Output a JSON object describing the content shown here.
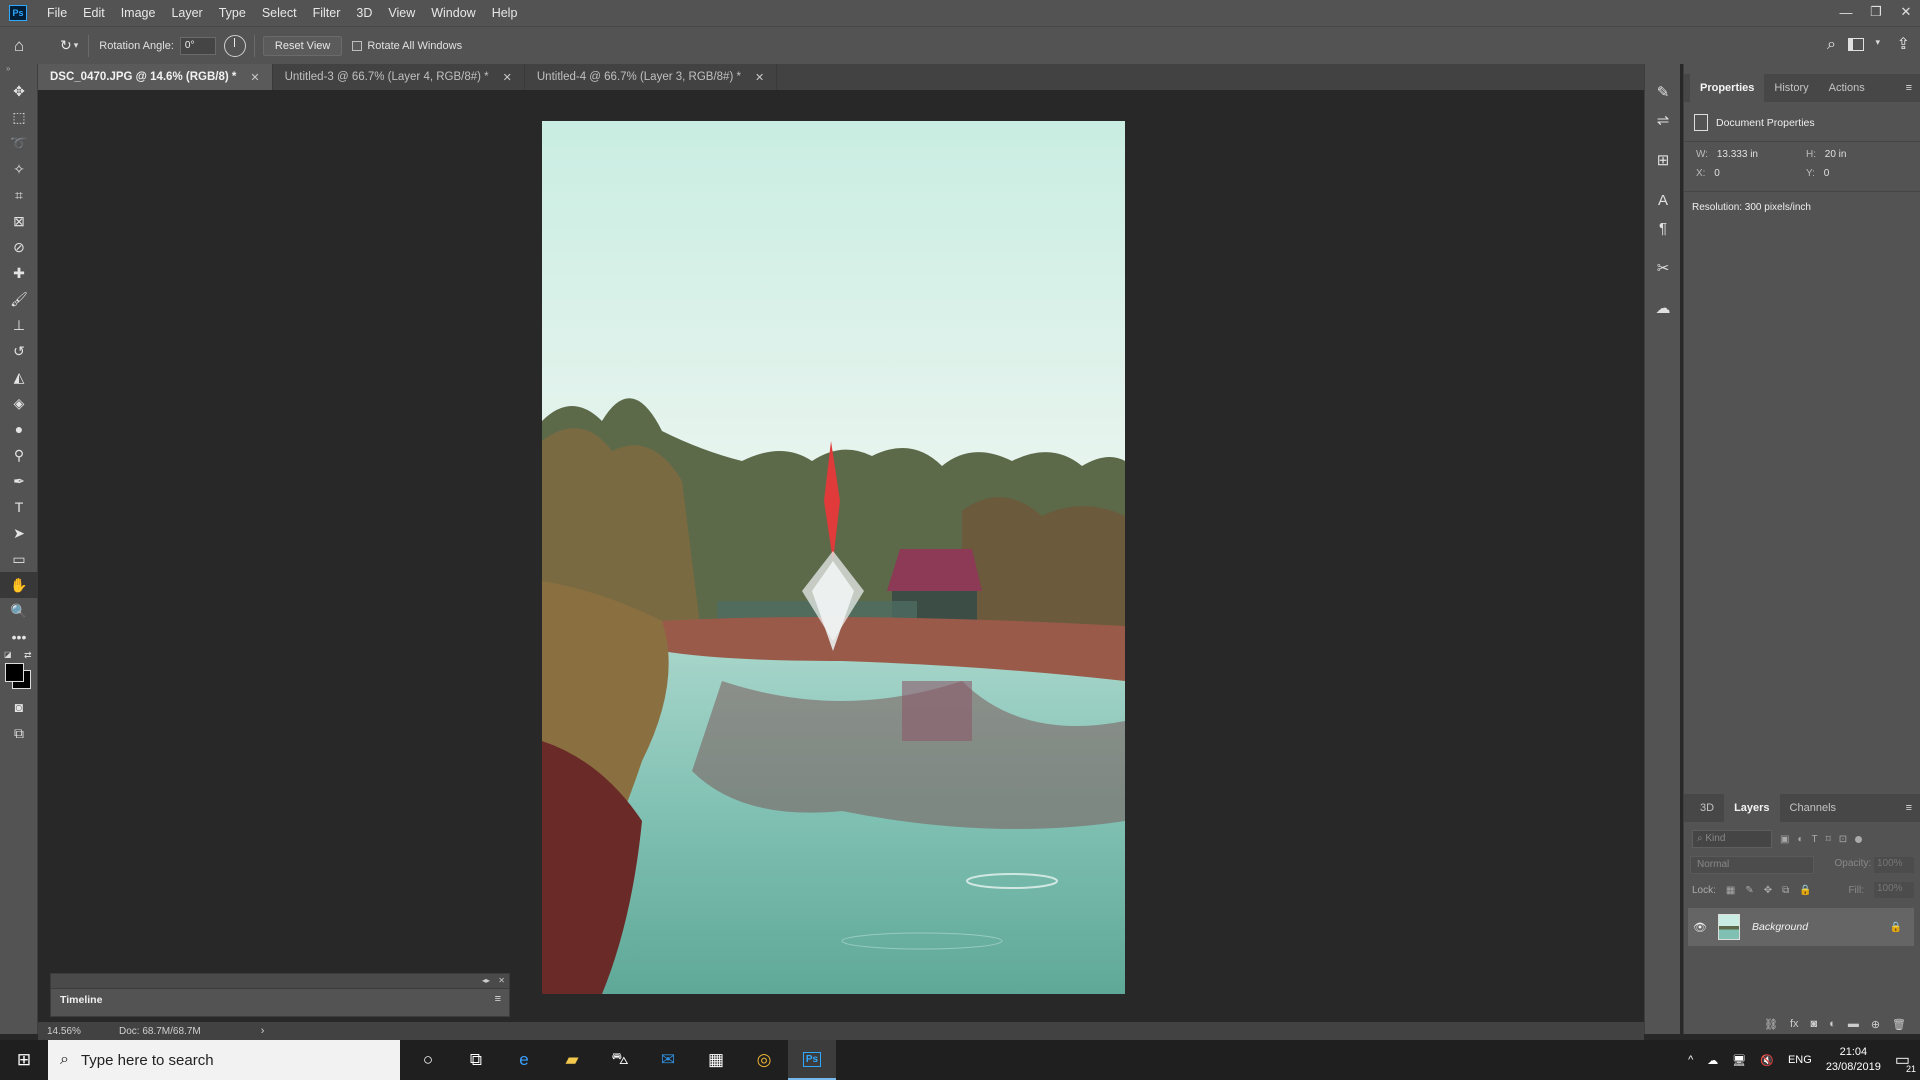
{
  "menubar": {
    "logo": "Ps",
    "items": [
      "File",
      "Edit",
      "Image",
      "Layer",
      "Type",
      "Select",
      "Filter",
      "3D",
      "View",
      "Window",
      "Help"
    ]
  },
  "options": {
    "rotation_label": "Rotation Angle:",
    "rotation_value": "0°",
    "reset_view": "Reset View",
    "rotate_all": "Rotate All Windows"
  },
  "tabs": [
    {
      "label": "DSC_0470.JPG @ 14.6% (RGB/8) *",
      "active": true
    },
    {
      "label": "Untitled-3 @ 66.7% (Layer 4, RGB/8#) *",
      "active": false
    },
    {
      "label": "Untitled-4 @ 66.7% (Layer 3, RGB/8#) *",
      "active": false
    }
  ],
  "timeline": {
    "title": "Timeline"
  },
  "status": {
    "zoom": "14.56%",
    "doc": "Doc: 68.7M/68.7M"
  },
  "properties": {
    "tabs": [
      "Properties",
      "History",
      "Actions"
    ],
    "section": "Document Properties",
    "w_label": "W:",
    "w_value": "13.333 in",
    "h_label": "H:",
    "h_value": "20 in",
    "x_label": "X:",
    "x_value": "0",
    "y_label": "Y:",
    "y_value": "0",
    "resolution": "Resolution: 300 pixels/inch"
  },
  "layers": {
    "tabs": [
      "3D",
      "Layers",
      "Channels"
    ],
    "kind_placeholder": "Kind",
    "blend": "Normal",
    "opacity_label": "Opacity:",
    "opacity_value": "100%",
    "lock_label": "Lock:",
    "fill_label": "Fill:",
    "fill_value": "100%",
    "layer_name": "Background"
  },
  "taskbar": {
    "search_placeholder": "Type here to search",
    "lang": "ENG",
    "time": "21:04",
    "date": "23/08/2019",
    "notifications": "21"
  }
}
